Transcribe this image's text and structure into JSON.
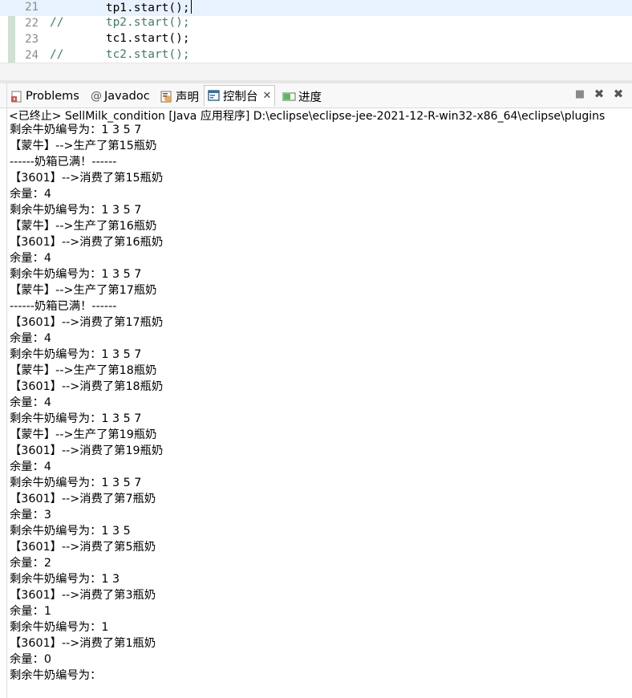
{
  "editor": {
    "lines": [
      {
        "num": "21",
        "text": "        tp1.start();",
        "comment": false
      },
      {
        "num": "22",
        "text": "//      tp2.start();",
        "comment": true
      },
      {
        "num": "23",
        "text": "        tc1.start();",
        "comment": false
      },
      {
        "num": "24",
        "text": "//      tc2.start();",
        "comment": true
      }
    ]
  },
  "tabs": [
    {
      "label": "Problems",
      "icon": "problems-icon"
    },
    {
      "label": "Javadoc",
      "icon": "javadoc-icon"
    },
    {
      "label": "声明",
      "icon": "declaration-icon"
    },
    {
      "label": "控制台",
      "icon": "console-icon",
      "close": "✕"
    },
    {
      "label": "进度",
      "icon": "progress-icon"
    }
  ],
  "toolbar": {
    "stop": "■",
    "remove": "✖",
    "remove_all": "✖"
  },
  "console": {
    "header": "<已终止> SellMilk_condition [Java 应用程序] D:\\eclipse\\eclipse-jee-2021-12-R-win32-x86_64\\eclipse\\plugins",
    "lines": [
      "剩余牛奶编号为：1 3 5 7",
      "【蒙牛】-->生产了第15瓶奶",
      "------奶箱已满！------",
      "【3601】-->消费了第15瓶奶",
      "余量：4",
      "剩余牛奶编号为：1 3 5 7",
      "【蒙牛】-->生产了第16瓶奶",
      "【3601】-->消费了第16瓶奶",
      "余量：4",
      "剩余牛奶编号为：1 3 5 7",
      "【蒙牛】-->生产了第17瓶奶",
      "------奶箱已满！------",
      "【3601】-->消费了第17瓶奶",
      "余量：4",
      "剩余牛奶编号为：1 3 5 7",
      "【蒙牛】-->生产了第18瓶奶",
      "【3601】-->消费了第18瓶奶",
      "余量：4",
      "剩余牛奶编号为：1 3 5 7",
      "【蒙牛】-->生产了第19瓶奶",
      "【3601】-->消费了第19瓶奶",
      "余量：4",
      "剩余牛奶编号为：1 3 5 7",
      "【3601】-->消费了第7瓶奶",
      "余量：3",
      "剩余牛奶编号为：1 3 5",
      "【3601】-->消费了第5瓶奶",
      "余量：2",
      "剩余牛奶编号为：1 3",
      "【3601】-->消费了第3瓶奶",
      "余量：1",
      "剩余牛奶编号为：1",
      "【3601】-->消费了第1瓶奶",
      "余量：0",
      "剩余牛奶编号为："
    ]
  }
}
